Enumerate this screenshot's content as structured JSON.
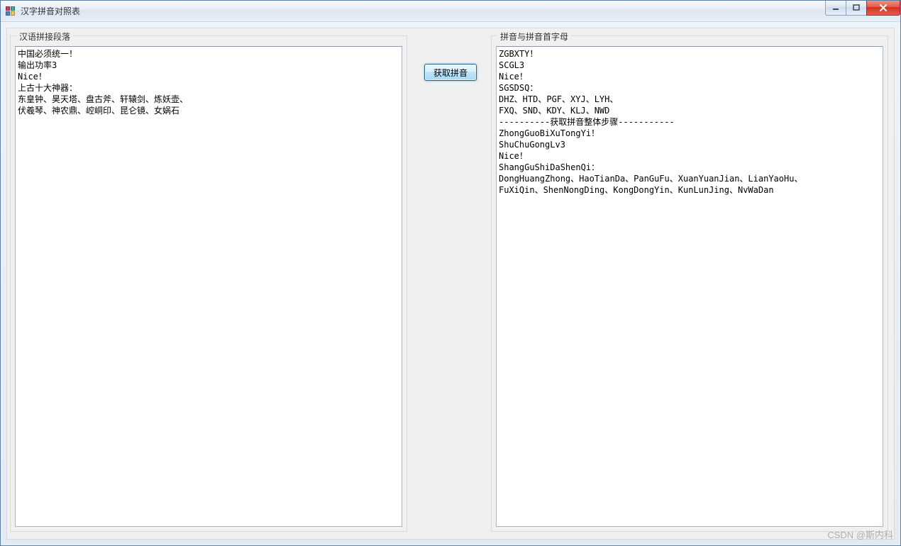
{
  "window": {
    "title": "汉字拼音对照表"
  },
  "labels": {
    "left_group": "汉语拼接段落",
    "right_group": "拼音与拼音首字母",
    "get_button": "获取拼音"
  },
  "left_text": "中国必须统一！\n输出功率3\nNice！\n上古十大神器：\n东皇钟、昊天塔、盘古斧、轩辕剑、炼妖壶、\n伏羲琴、神农鼎、崆峒印、昆仑镜、女娲石",
  "right_text": "ZGBXTY！\nSCGL3\nNice！\nSGSDSQ：\nDHZ、HTD、PGF、XYJ、LYH、\nFXQ、SND、KDY、KLJ、NWD\n----------获取拼音整体步骤-----------\nZhongGuoBiXuTongYi！\nShuChuGongLv3\nNice！\nShangGuShiDaShenQi：\nDongHuangZhong、HaoTianDa、PanGuFu、XuanYuanJian、LianYaoHu、\nFuXiQin、ShenNongDing、KongDongYin、KunLunJing、NvWaDan",
  "watermark": "CSDN @斯内科"
}
